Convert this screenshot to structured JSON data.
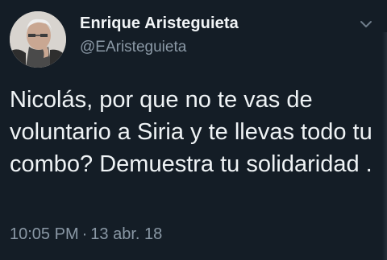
{
  "tweet": {
    "author": {
      "display_name": "Enrique Aristeguieta",
      "handle": "@EAristeguieta",
      "avatar_icon": "person-portrait"
    },
    "text": "Nicolás, por que no te vas de voluntario a Siria y te llevas todo tu combo? Demuestra tu solidaridad .",
    "time": "10:05 PM",
    "separator": "·",
    "date": "13 abr. 18",
    "menu_icon": "chevron-down-icon"
  },
  "colors": {
    "background": "#141d26",
    "text_primary": "#eff3f5",
    "text_secondary": "#8a98a5"
  }
}
